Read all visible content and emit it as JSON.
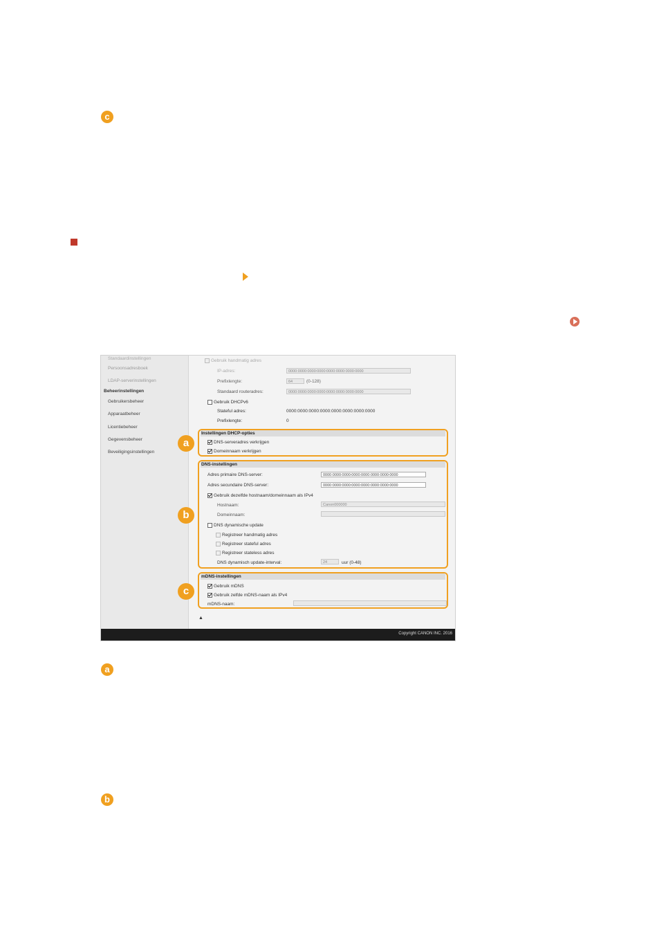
{
  "markers": {
    "top_c": "c",
    "callout_a": "a",
    "callout_b": "b",
    "callout_c": "c",
    "bottom_a": "a",
    "bottom_b": "b"
  },
  "sidebar": {
    "items_top": [
      "Standaardinstellingen",
      "Persoonsadresboek",
      "LDAP-serverinstellingen"
    ],
    "section_head": "Beheerinstellingen",
    "items": [
      "Gebruikersbeheer",
      "Apparaatbeheer",
      "Licentiebeheer",
      "Gegevensbeheer",
      "Beveiligingsinstellingen"
    ]
  },
  "ipv6": {
    "manual_label": "Gebruik handmatig adres",
    "ip_label": "IP-adres:",
    "ip_value": "0000:0000:0000:0000:0000:0000:0000:0000",
    "prefix_label": "Prefixlengte:",
    "prefix_value": "64",
    "prefix_range": "(0-128)",
    "router_label": "Standaard routeradres:",
    "router_value": "0000:0000:0000:0000:0000:0000:0000:0000",
    "dhcp_label": "Gebruik DHCPv6",
    "stateful_label": "Stateful adres:",
    "stateful_value": "0000:0000:0000:0000:0000:0000:0000:0000",
    "prefix2_label": "Prefixlengte:",
    "prefix2_value": "0"
  },
  "dhcp_section": {
    "title": "Instellingen DHCP-opties",
    "opt1": "DNS-serveradres verkrijgen",
    "opt2": "Domeinnaam verkrijgen"
  },
  "dns_section": {
    "title": "DNS-instellingen",
    "primary_label": "Adres primaire DNS-server:",
    "primary_value": "0000:0000:0000:0000:0000:0000:0000:0000",
    "secondary_label": "Adres secundaire DNS-server:",
    "secondary_value": "0000:0000:0000:0000:0000:0000:0000:0000",
    "same_host_label": "Gebruik dezelfde hostnaam/domeinnaam als IPv4",
    "hostname_label": "Hostnaam:",
    "hostname_value": "Canon000000",
    "domain_label": "Domeinnaam:",
    "dyn_update_label": "DNS dynamische update",
    "reg_manual": "Registreer handmatig adres",
    "reg_stateful": "Registreer stateful adres",
    "reg_stateless": "Registreer stateless adres",
    "interval_label": "DNS dynamisch update-interval:",
    "interval_value": "24",
    "interval_unit": "uur (0-48)"
  },
  "mdns_section": {
    "title": "mDNS-instellingen",
    "use_mdns": "Gebruik mDNS",
    "same_name": "Gebruik zelfde mDNS-naam als IPv4",
    "name_label": "mDNS-naam:"
  },
  "footer": {
    "copyright": "Copyright CANON INC. 2016"
  },
  "colors": {
    "accent": "#f0a020",
    "bullet": "#c0392b"
  }
}
